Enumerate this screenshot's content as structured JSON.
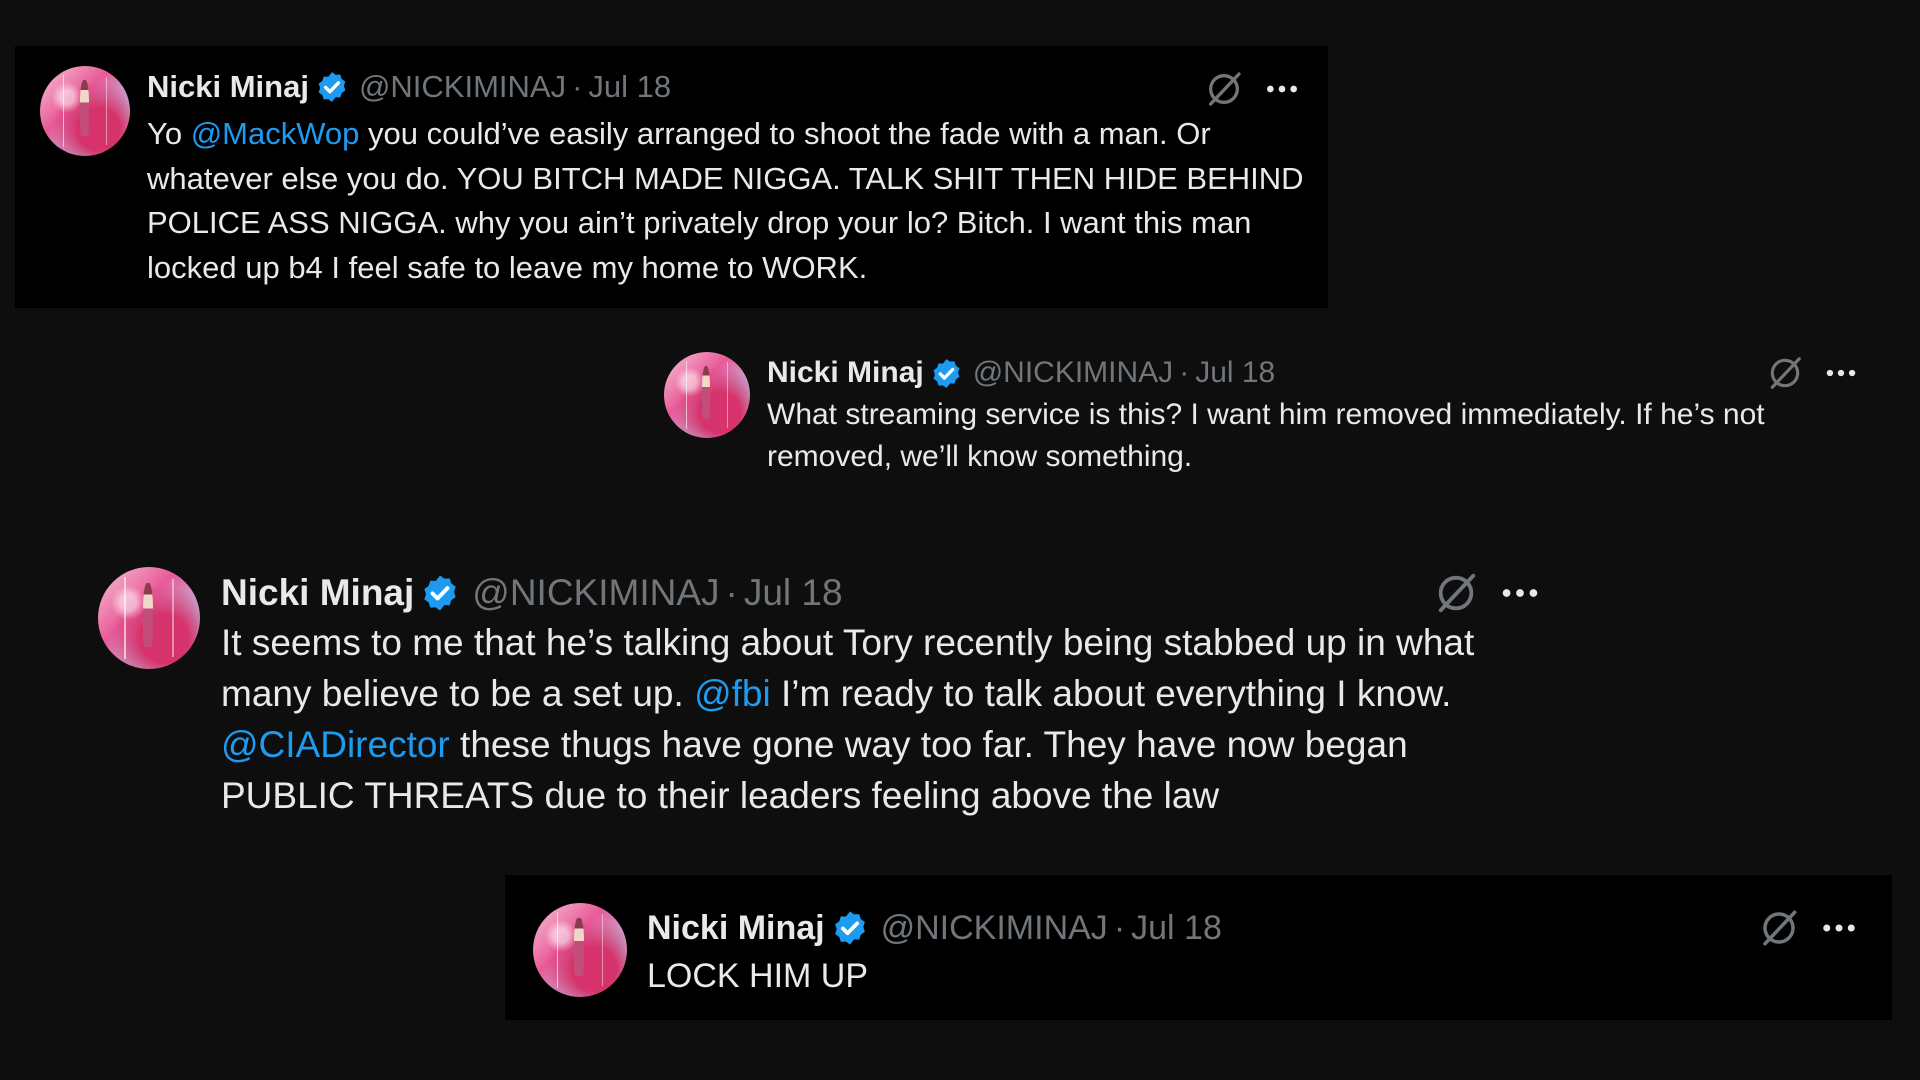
{
  "colors": {
    "background": "#0e0e0e",
    "card": "#000000",
    "text": "#e7e9ea",
    "muted": "#71767b",
    "link": "#1d9bf0",
    "verified": "#1d9bf0"
  },
  "icons": {
    "verified": "verified-badge-icon",
    "grok": "grok-icon",
    "more": "more-horizontal-icon"
  },
  "tweets": [
    {
      "name": "Nicki Minaj",
      "handle": "@NICKIMINAJ",
      "separator": "·",
      "date": "Jul 18",
      "segments": [
        {
          "text": "Yo ",
          "type": "text"
        },
        {
          "text": "@MackWop",
          "type": "mention"
        },
        {
          "text": " you could’ve easily arranged to shoot the fade with a man. Or whatever else you do. YOU BITCH MADE NIGGA. TALK SHIT THEN HIDE BEHIND POLICE ASS NIGGA. why you ain’t privately drop your lo? Bitch. I want this man locked up b4 I feel safe to leave my home to WORK.",
          "type": "text"
        }
      ]
    },
    {
      "name": "Nicki Minaj",
      "handle": "@NICKIMINAJ",
      "separator": "·",
      "date": "Jul 18",
      "segments": [
        {
          "text": "What streaming service is this? I want him removed immediately. If he’s not removed, we’ll know something.",
          "type": "text"
        }
      ]
    },
    {
      "name": "Nicki Minaj",
      "handle": "@NICKIMINAJ",
      "separator": "·",
      "date": "Jul 18",
      "segments": [
        {
          "text": "It seems to me that he’s talking about Tory recently being stabbed up in what many believe to be a set up. ",
          "type": "text"
        },
        {
          "text": "@fbi",
          "type": "mention"
        },
        {
          "text": " I’m ready to talk about everything I know. ",
          "type": "text"
        },
        {
          "text": "@CIADirector",
          "type": "mention"
        },
        {
          "text": " these thugs have gone way too far. They have now began PUBLIC THREATS due to their leaders feeling above the law",
          "type": "text"
        }
      ]
    },
    {
      "name": "Nicki Minaj",
      "handle": "@NICKIMINAJ",
      "separator": "·",
      "date": "Jul 18",
      "segments": [
        {
          "text": "LOCK HIM UP",
          "type": "text"
        }
      ]
    }
  ]
}
